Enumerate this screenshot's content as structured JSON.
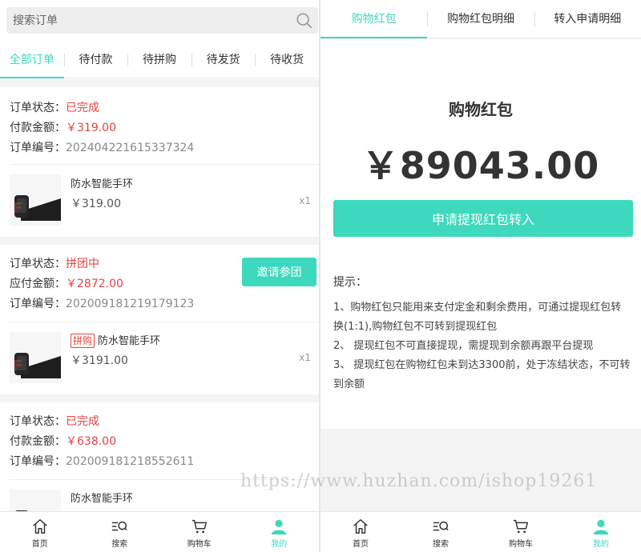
{
  "left": {
    "search": {
      "placeholder": "搜索订单"
    },
    "tabs": [
      "全部订单",
      "待付款",
      "待拼购",
      "待发货",
      "待收货"
    ],
    "orders": [
      {
        "status_label": "订单状态：",
        "status": "已完成",
        "amount_label": "付款金额：",
        "amount": "￥319.00",
        "no_label": "订单编号：",
        "no": "2024042216153373 24",
        "product_name": "防水智能手环",
        "product_price": "￥319.00",
        "qty": "x1"
      },
      {
        "status_label": "订单状态：",
        "status": "拼团中",
        "amount_label": "应付金额：",
        "amount": "￥2872.00",
        "no_label": "订单编号：",
        "no": "202009181219179123",
        "tag": "拼购",
        "product_name": "防水智能手环",
        "product_price": "￥3191.00",
        "qty": "x1",
        "action": "邀请参团"
      },
      {
        "status_label": "订单状态：",
        "status": "已完成",
        "amount_label": "付款金额：",
        "amount": "￥638.00",
        "no_label": "订单编号：",
        "no": "202009181218552611",
        "product_name": "防水智能手环"
      }
    ]
  },
  "nav": [
    "首页",
    "搜索",
    "购物车",
    "我的"
  ],
  "right": {
    "tabs": [
      "购物红包",
      "购物红包明细",
      "转入申请明细"
    ],
    "title": "购物红包",
    "amount": "￥89043.00",
    "button": "申请提现红包转入",
    "tips_title": "提示：",
    "tips": [
      "1、购物红包只能用来支付定金和剩余费用，可通过提现红包转换(1:1),购物红包不可转到提现红包",
      "2、 提现红包不可直接提现，需提现到余额再跟平台提现",
      "3、 提现红包在购物红包未到达3300前，处于冻结状态，不可转到余额"
    ]
  },
  "watermark": "https://www.huzhan.com/ishop19261",
  "colors": {
    "accent": "#3ed8be",
    "price_red": "#e64340"
  }
}
